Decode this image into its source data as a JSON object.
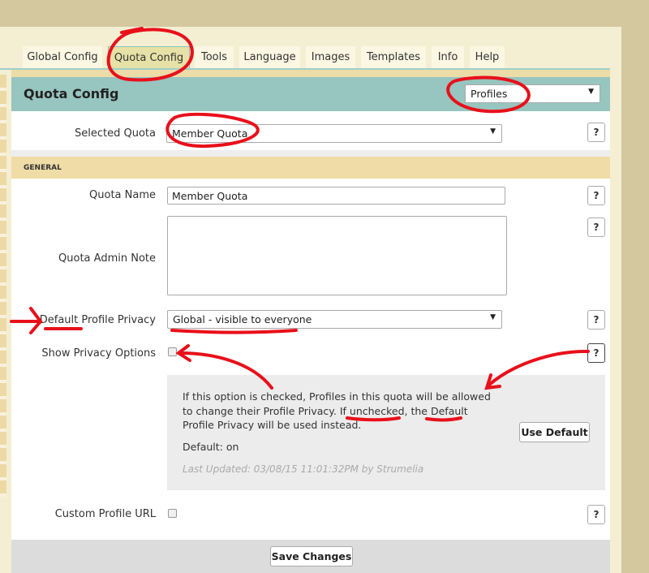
{
  "tabs": [
    {
      "label": "Global Config"
    },
    {
      "label": "Quota Config"
    },
    {
      "label": "Tools"
    },
    {
      "label": "Language"
    },
    {
      "label": "Images"
    },
    {
      "label": "Templates"
    },
    {
      "label": "Info"
    },
    {
      "label": "Help"
    }
  ],
  "header": {
    "title": "Quota Config",
    "section_select": "Profiles"
  },
  "selected_quota": {
    "label": "Selected Quota",
    "value": "Member Quota"
  },
  "section_title": "GENERAL",
  "fields": {
    "quota_name": {
      "label": "Quota Name",
      "value": "Member Quota"
    },
    "admin_note": {
      "label": "Quota Admin Note",
      "value": ""
    },
    "default_privacy": {
      "label": "Default Profile Privacy",
      "value": "Global - visible to everyone"
    },
    "show_privacy": {
      "label": "Show Privacy Options",
      "checked": false
    },
    "custom_url": {
      "label": "Custom Profile URL",
      "checked": false
    }
  },
  "help_label": "?",
  "dropdown_arrow": "▼",
  "info": {
    "line1": "If this option is checked, Profiles in this quota will be allowed",
    "line2": "to change their Profile Privacy. If unchecked, the Default",
    "line3": "Profile Privacy will be used instead.",
    "default": "Default: on",
    "updated": "Last Updated: 03/08/15 11:01:32PM by Strumelia",
    "use_default": "Use Default"
  },
  "save_label": "Save Changes",
  "annotation_color": "#e8101a"
}
